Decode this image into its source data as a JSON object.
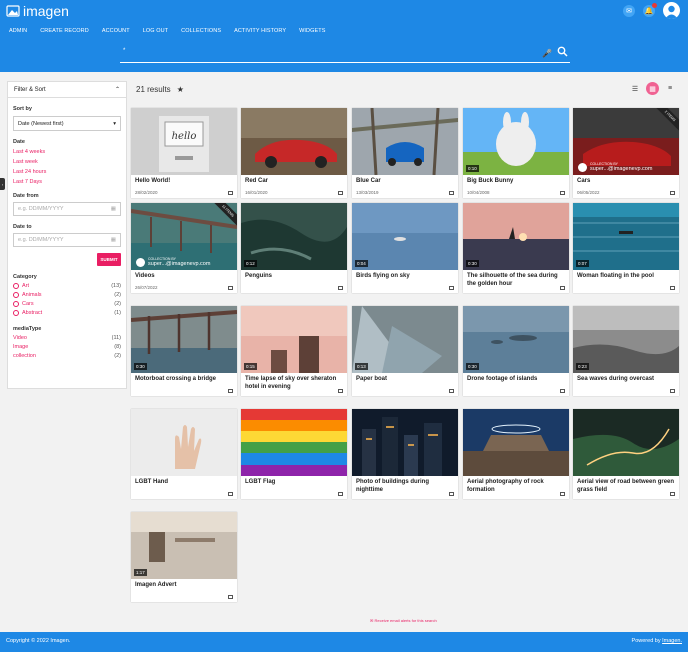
{
  "app": {
    "brand": "imagen"
  },
  "nav": [
    "ADMIN",
    "CREATE RECORD",
    "ACCOUNT",
    "LOG OUT",
    "COLLECTIONS",
    "ACTIVITY HISTORY",
    "WIDGETS"
  ],
  "search": {
    "value": "*"
  },
  "sidebar": {
    "header": "Filter & Sort",
    "sort_by_label": "Sort by",
    "sort_value": "Date (Newest first)",
    "date_label": "Date",
    "date_links": [
      "Last 4 weeks",
      "Last week",
      "Last 24 hours",
      "Last 7 Days"
    ],
    "date_from_label": "Date from",
    "date_from_placeholder": "e.g. DD/MM/YYYY",
    "date_to_label": "Date to",
    "date_to_placeholder": "e.g. DD/MM/YYYY",
    "submit_label": "SUBMIT",
    "category_label": "Category",
    "categories": [
      {
        "name": "Art",
        "count": "(13)"
      },
      {
        "name": "Animals",
        "count": "(2)"
      },
      {
        "name": "Cars",
        "count": "(2)"
      },
      {
        "name": "Abstract",
        "count": "(1)"
      }
    ],
    "mediatype_label": "mediaType",
    "mediatypes": [
      {
        "name": "Video",
        "count": "(11)"
      },
      {
        "name": "Image",
        "count": "(8)"
      },
      {
        "name": "collection",
        "count": "(2)"
      }
    ]
  },
  "results": {
    "count_text": "21 results"
  },
  "cards": [
    {
      "title": "Hello World!",
      "date": "28/02/2020",
      "duration": "",
      "type": "image"
    },
    {
      "title": "Red Car",
      "date": "16/01/2020",
      "duration": "",
      "type": "image"
    },
    {
      "title": "Blue Car",
      "date": "13/03/2019",
      "duration": "",
      "type": "image"
    },
    {
      "title": "Big Buck Bunny",
      "date": "10/04/2008",
      "duration": "0:10",
      "type": "video"
    },
    {
      "title": "Cars",
      "date": "06/05/2022",
      "duration": "",
      "type": "collection",
      "banner": "2 ITEMS",
      "collection_by": "COLLECTION BY",
      "owner": "super...@imagenevp.com"
    },
    {
      "title": "Videos",
      "date": "26/07/2022",
      "duration": "",
      "type": "collection",
      "banner": "11 ITEMS",
      "collection_by": "COLLECTION BY",
      "owner": "super...@imagenevp.com"
    },
    {
      "title": "Penguins",
      "date": "",
      "duration": "0:12",
      "type": "video"
    },
    {
      "title": "Birds flying on sky",
      "date": "",
      "duration": "0:04",
      "type": "video"
    },
    {
      "title": "The silhouette of the sea during the golden hour",
      "date": "",
      "duration": "0:30",
      "type": "video"
    },
    {
      "title": "Woman floating in the pool",
      "date": "",
      "duration": "0:07",
      "type": "video"
    },
    {
      "title": "Motorboat crossing a bridge",
      "date": "",
      "duration": "0:30",
      "type": "video"
    },
    {
      "title": "Time lapse of sky over sheraton hotel in evening",
      "date": "",
      "duration": "0:15",
      "type": "video"
    },
    {
      "title": "Paper boat",
      "date": "",
      "duration": "0:13",
      "type": "video"
    },
    {
      "title": "Drone footage of islands",
      "date": "",
      "duration": "0:30",
      "type": "video"
    },
    {
      "title": "Sea waves during overcast",
      "date": "",
      "duration": "0:23",
      "type": "video"
    },
    {
      "title": "LGBT Hand",
      "date": "",
      "duration": "",
      "type": "image"
    },
    {
      "title": "LGBT Flag",
      "date": "",
      "duration": "",
      "type": "image"
    },
    {
      "title": "Photo of buildings during nighttime",
      "date": "",
      "duration": "",
      "type": "image"
    },
    {
      "title": "Aerial photography of rock formation",
      "date": "",
      "duration": "",
      "type": "image"
    },
    {
      "title": "Aerial view of road between green grass field",
      "date": "",
      "duration": "",
      "type": "image"
    },
    {
      "title": "Imagen Advert",
      "date": "",
      "duration": "1:17",
      "type": "video"
    }
  ],
  "alerts_text": "Receive email alerts for this search",
  "footer": {
    "left": "Copyright © 2022 Imagen.",
    "right_prefix": "Powered by ",
    "right_link": "Imagen."
  },
  "colors": {
    "primary": "#1e88e5",
    "accent": "#e91e63"
  }
}
